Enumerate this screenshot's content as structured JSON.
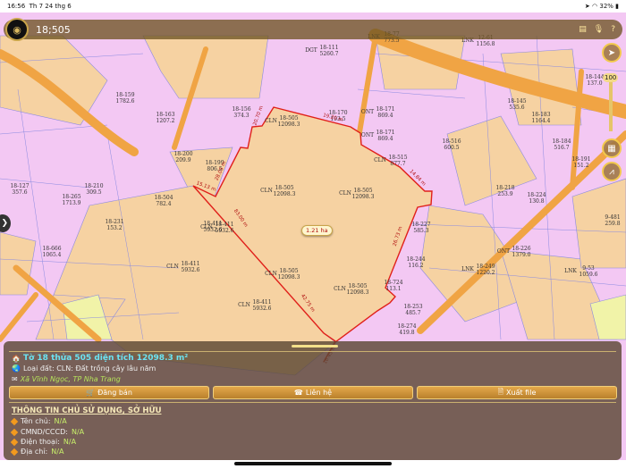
{
  "status_bar": {
    "time": "16:56",
    "date": "Th 7 24 thg 6",
    "battery": "32%"
  },
  "top_bar": {
    "search_value": "18;505"
  },
  "map": {
    "zoom_level": "100",
    "area_badge": "1.21 ha",
    "edge_lengths": [
      "19.20 m",
      "14.84 m",
      "26.73 m",
      "42.75 m",
      "83.00 m",
      "15.13 m",
      "28.05 m",
      "20.70 m",
      "16.45 m"
    ],
    "parcels": [
      [
        "CLN",
        "18-505",
        "12098.3"
      ],
      [
        "CLN",
        "18-505",
        "12098.3"
      ],
      [
        "CLN",
        "18-505",
        "12098.3"
      ],
      [
        "CLN",
        "18-505",
        "12098.3"
      ],
      [
        "CLN",
        "18-505",
        "12098.3"
      ],
      [
        "CLN",
        "18-411",
        "5932.6"
      ],
      [
        "",
        "18-411",
        "5932.6"
      ],
      [
        "CLN",
        "18-411",
        "5932.6"
      ],
      [
        "CLN",
        "18-411",
        "5932.6"
      ],
      [
        "",
        "18-199",
        "806.5"
      ],
      [
        "",
        "18-200",
        "209.9"
      ],
      [
        "",
        "18-156",
        "374.3"
      ],
      [
        "",
        "18-163",
        "1207.2"
      ],
      [
        "",
        "18-170",
        "193.5"
      ],
      [
        "ONT",
        "18-171",
        "869.4"
      ],
      [
        "ONT",
        "18-171",
        "869.4"
      ],
      [
        "CLN",
        "18-515",
        "877.7"
      ],
      [
        "",
        "18-227",
        "585.3"
      ],
      [
        "",
        "18-244",
        "116.2"
      ],
      [
        "",
        "18-253",
        "485.7"
      ],
      [
        "",
        "18-274",
        "419.8"
      ],
      [
        "",
        "18-724",
        "113.1"
      ],
      [
        "",
        "18-159",
        "1782.6"
      ],
      [
        "",
        "18-265",
        "1713.9"
      ],
      [
        "",
        "18-666",
        "1065.4"
      ],
      [
        "",
        "18-127",
        "357.6"
      ],
      [
        "",
        "18-504",
        "782.4"
      ],
      [
        "DGT",
        "18-111",
        "5260.7"
      ],
      [
        "LNK",
        "18-77",
        "773.5"
      ],
      [
        "LNK",
        "12-61",
        "1156.8"
      ],
      [
        "",
        "18-145",
        "535.6"
      ],
      [
        "",
        "18-183",
        "1164.4"
      ],
      [
        "ONT",
        "18-226",
        "1379.0"
      ],
      [
        "LNK",
        "9-53",
        "1059.6"
      ],
      [
        "",
        "18-144",
        "137.0"
      ],
      [
        "",
        "18-184",
        "516.7"
      ],
      [
        "",
        "18-191",
        "151.2"
      ],
      [
        "LNK",
        "18-249",
        "1220.2"
      ],
      [
        "",
        "18-516",
        "600.5"
      ],
      [
        "",
        "18-218",
        "253.9"
      ],
      [
        "",
        "18-224",
        "130.8"
      ],
      [
        "",
        "9-481",
        "259.8"
      ],
      [
        "",
        "18-210",
        "309.5"
      ],
      [
        "",
        "18-231",
        "153.2"
      ]
    ]
  },
  "panel": {
    "title": "Tờ 18 thửa 505 diện tích 12098.3 m²",
    "land_type": "Loại đất: CLN: Đất trồng cây lâu năm",
    "address": "Xã Vĩnh Ngọc, TP Nha Trang",
    "buttons": {
      "sell": "Đăng bán",
      "contact": "Liên hệ",
      "export": "Xuất file"
    },
    "owner_section": "THÔNG TIN CHỦ SỬ DỤNG, SỞ HỮU",
    "owner_fields": [
      {
        "label": "Tên chủ:",
        "value": "N/A"
      },
      {
        "label": "CMND/CCCD:",
        "value": "N/A"
      },
      {
        "label": "Điện thoại:",
        "value": "N/A"
      },
      {
        "label": "Địa chỉ:",
        "value": "N/A"
      }
    ]
  }
}
